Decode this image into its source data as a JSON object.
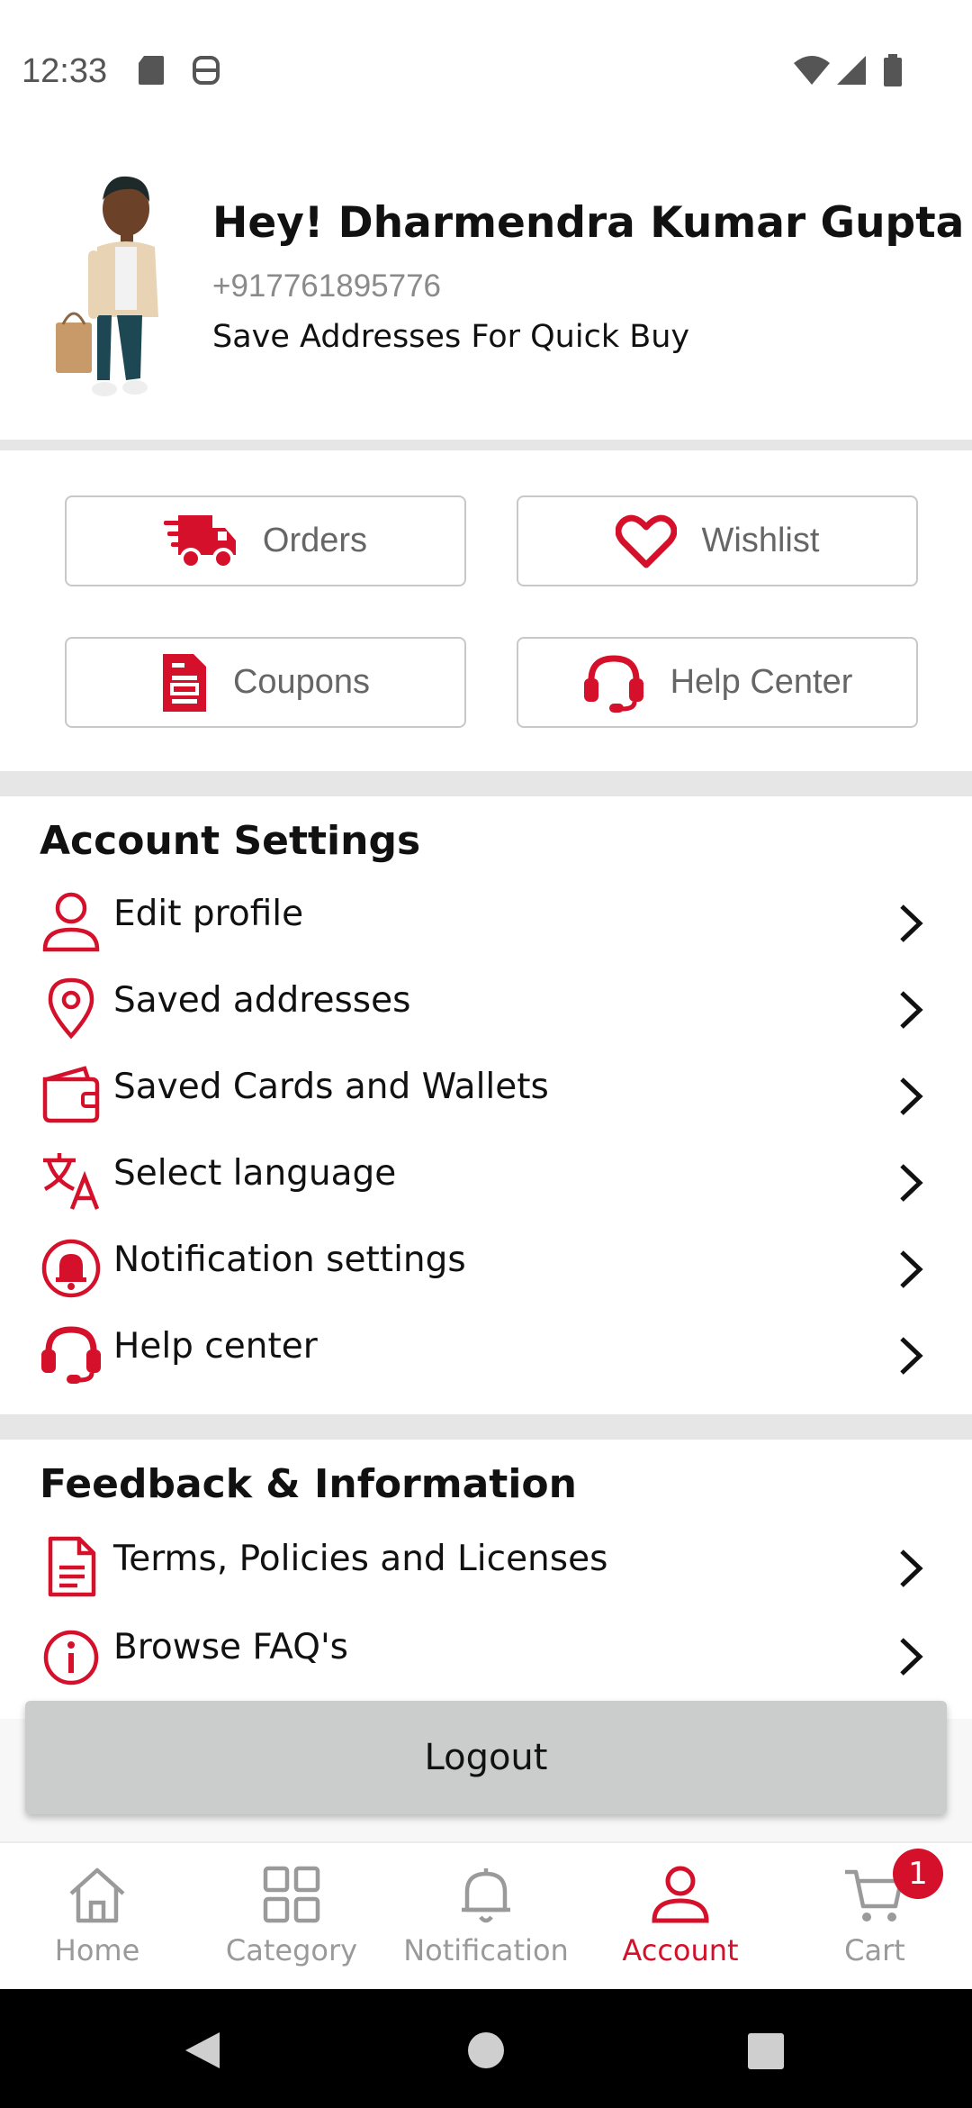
{
  "status_bar": {
    "time": "12:33"
  },
  "profile": {
    "name": "Hey! Dharmendra Kumar Gupta",
    "phone": "+917761895776",
    "save_addresses": "Save Addresses For Quick Buy"
  },
  "quick_actions": [
    {
      "label": "Orders",
      "icon": "truck-icon"
    },
    {
      "label": "Wishlist",
      "icon": "heart-icon"
    },
    {
      "label": "Coupons",
      "icon": "coupon-icon"
    },
    {
      "label": "Help Center",
      "icon": "headset-icon"
    }
  ],
  "account_settings": {
    "title": "Account Settings",
    "items": [
      {
        "label": "Edit profile",
        "icon": "user-icon"
      },
      {
        "label": "Saved addresses",
        "icon": "location-pin-icon"
      },
      {
        "label": "Saved Cards and Wallets",
        "icon": "wallet-icon"
      },
      {
        "label": "Select language",
        "icon": "translate-icon"
      },
      {
        "label": "Notification settings",
        "icon": "bell-icon"
      },
      {
        "label": "Help center",
        "icon": "headset-icon"
      }
    ]
  },
  "feedback": {
    "title": "Feedback & Information",
    "items": [
      {
        "label": "Terms, Policies and Licenses",
        "icon": "document-icon"
      },
      {
        "label": "Browse FAQ's",
        "icon": "info-icon"
      }
    ]
  },
  "logout_label": "Logout",
  "bottom_nav": {
    "items": [
      {
        "label": "Home",
        "icon": "home-icon"
      },
      {
        "label": "Category",
        "icon": "grid-icon"
      },
      {
        "label": "Notification",
        "icon": "bell-icon"
      },
      {
        "label": "Account",
        "icon": "user-icon"
      },
      {
        "label": "Cart",
        "icon": "cart-icon"
      }
    ],
    "active": "Account",
    "cart_badge": "1"
  },
  "colors": {
    "accent": "#d4102a",
    "muted": "#9a9a9a",
    "button_gray": "#cbcccc"
  }
}
